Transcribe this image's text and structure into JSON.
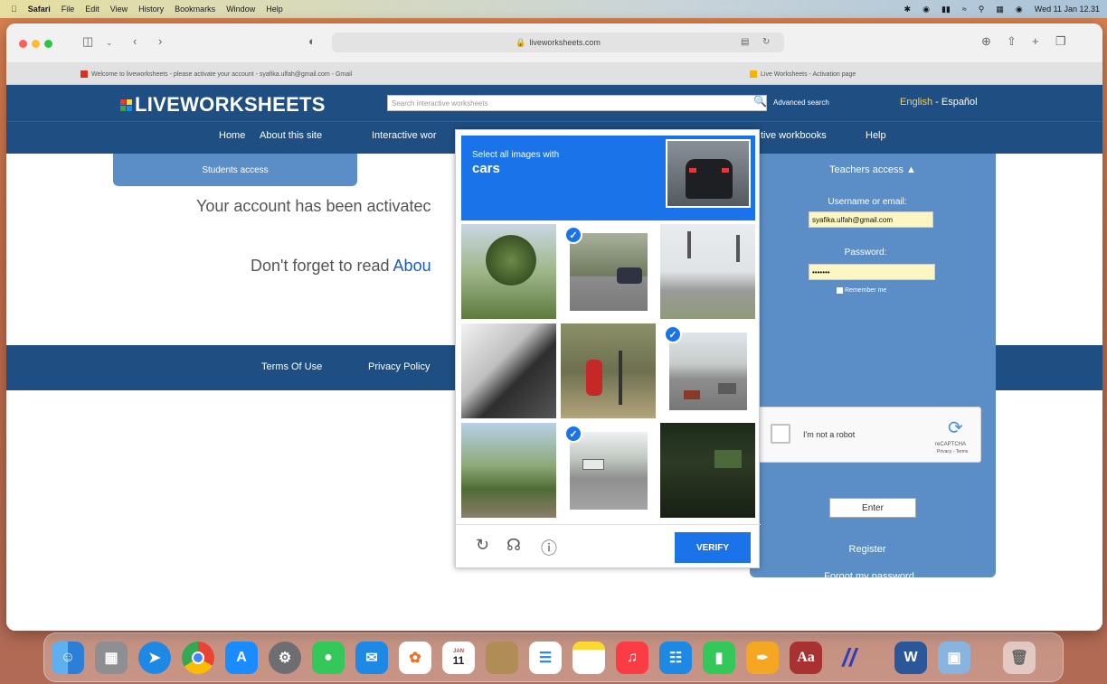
{
  "menubar": {
    "apple": "",
    "app": "Safari",
    "items": [
      "File",
      "Edit",
      "View",
      "History",
      "Bookmarks",
      "Window",
      "Help"
    ],
    "clock": "Wed 11 Jan 12.31"
  },
  "browser": {
    "url": "liveworksheets.com",
    "tabs": [
      {
        "title": "Welcome to liveworksheets - please activate your account - syafika.ulfah@gmail.com - Gmail",
        "favicon_color": "#d93025"
      },
      {
        "title": "Live Worksheets - Activation page",
        "favicon_color": "#f4b400"
      }
    ]
  },
  "site": {
    "logo_text": "LIVEWORKSHEETS",
    "search_placeholder": "Search interactive worksheets",
    "advanced_search": "Advanced search",
    "lang_english": "English",
    "lang_sep": " - ",
    "lang_spanish": "Español",
    "nav": [
      "Home",
      "About this site",
      "Interactive wor",
      "tive workbooks",
      "Help"
    ],
    "students_access": "Students access",
    "activated_msg": "Your account has been activatec",
    "reminder_prefix": "Don't forget to read ",
    "reminder_link": "Abou",
    "footer_links": [
      "Terms Of Use",
      "Privacy Policy"
    ]
  },
  "teachers": {
    "title": "Teachers access",
    "username_label": "Username or email:",
    "username_value": "syafika.ulfah@gmail.com",
    "password_label": "Password:",
    "password_value": "•••••••",
    "remember": "Remember me",
    "recaptcha_label": "I'm not a robot",
    "recaptcha_brand": "reCAPTCHA",
    "recaptcha_links": "Privacy - Terms",
    "enter": "Enter",
    "register": "Register",
    "forgot": "Forgot my password"
  },
  "captcha": {
    "instruction": "Select all images with",
    "target": "cars",
    "verify": "VERIFY",
    "tiles": [
      {
        "content": "palm trees",
        "selected": false
      },
      {
        "content": "street with car",
        "selected": true
      },
      {
        "content": "traffic lights",
        "selected": false
      },
      {
        "content": "palm fronds",
        "selected": false
      },
      {
        "content": "fire hydrant",
        "selected": false
      },
      {
        "content": "road with cars",
        "selected": true
      },
      {
        "content": "palm trees house",
        "selected": false
      },
      {
        "content": "road with cars",
        "selected": true
      },
      {
        "content": "dark trees",
        "selected": false
      }
    ]
  },
  "dock": {
    "apps": [
      "Finder",
      "Launchpad",
      "Safari",
      "Chrome",
      "App Store",
      "System Settings",
      "Messages",
      "Mail",
      "Photos",
      "Calendar",
      "Notes folder",
      "Reminders",
      "Notes",
      "Music",
      "Keynote",
      "Numbers",
      "Pages",
      "Dictionary",
      "GeoGebra",
      "Word",
      "Preview",
      "Trash"
    ],
    "calendar_day": "11",
    "calendar_month": "JAN"
  }
}
